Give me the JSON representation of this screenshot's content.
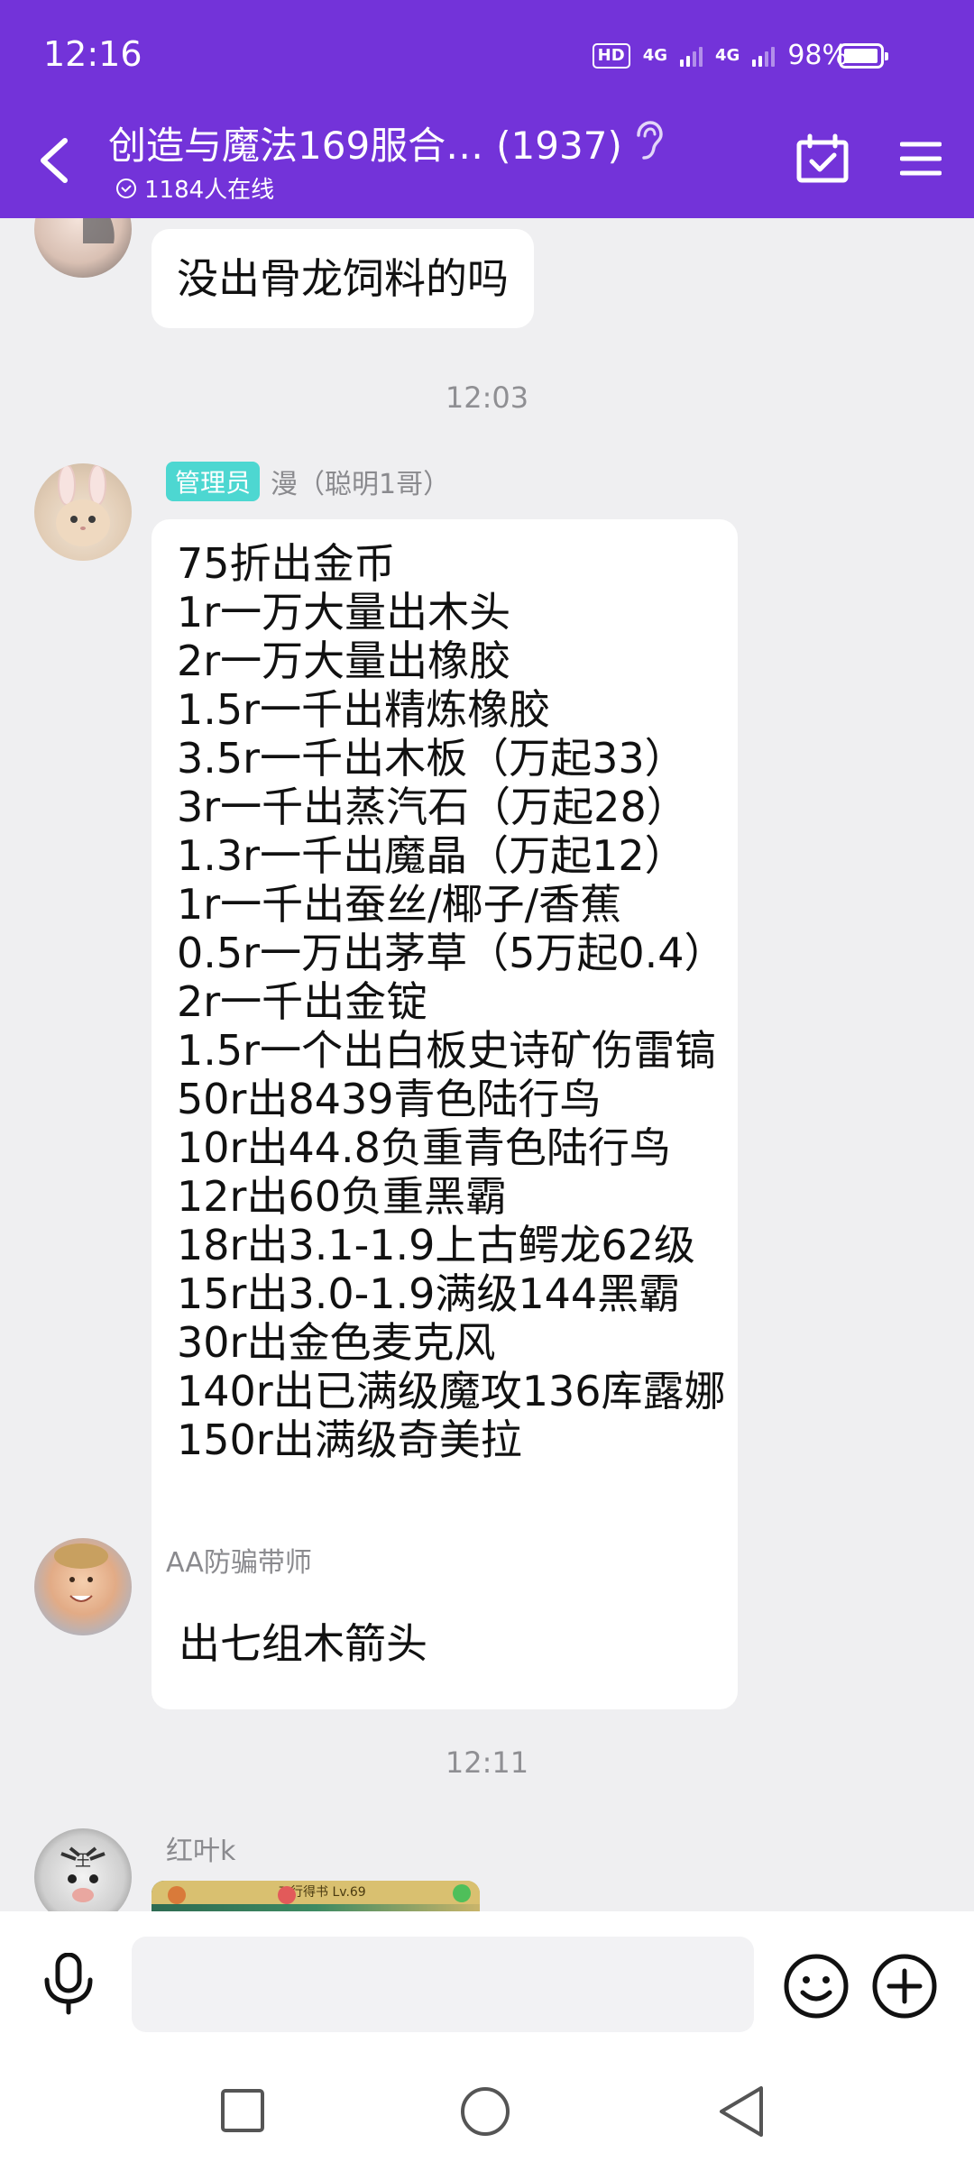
{
  "status_bar": {
    "time": "12:16",
    "hd": "HD",
    "network1": "4G",
    "network2": "4G",
    "battery": "98%"
  },
  "header": {
    "title": "创造与魔法169服合…",
    "member_count": "(1937)",
    "online": "1184人在线",
    "icons": [
      "back-icon",
      "ear-icon",
      "calendar-check-icon",
      "menu-icon"
    ]
  },
  "messages": [
    {
      "type": "text",
      "text": "没出骨龙饲料的吗"
    },
    {
      "type": "time",
      "text": "12:03"
    },
    {
      "type": "text",
      "badge": "管理员",
      "sender": "漫（聪明1哥）",
      "lines": [
        "75折出金币",
        "1r一万大量出木头",
        "2r一万大量出橡胶",
        "1.5r一千出精炼橡胶",
        "3.5r一千出木板（万起33）",
        "3r一千出蒸汽石（万起28）",
        "1.3r一千出魔晶（万起12）",
        "1r一千出蚕丝/椰子/香蕉",
        "0.5r一万出茅草（5万起0.4）",
        "2r一千出金锭",
        "1.5r一个出白板史诗矿伤雷镐",
        "50r出8439青色陆行鸟",
        "10r出44.8负重青色陆行鸟",
        "12r出60负重黑霸",
        "18r出3.1-1.9上古鳄龙62级",
        "15r出3.0-1.9满级144黑霸",
        "30r出金色麦克风",
        "140r出已满级魔攻136库露娜",
        "150r出满级奇美拉"
      ]
    },
    {
      "type": "text",
      "sender": "AA防骗带师",
      "text": "出七组木箭头"
    },
    {
      "type": "time",
      "text": "12:11"
    },
    {
      "type": "image",
      "sender": "红叶k",
      "image_caption": "三行得书 Lv.69"
    }
  ],
  "input": {
    "placeholder": ""
  },
  "colors": {
    "header": "#7333d9",
    "admin_badge": "#4dd7d1",
    "background": "#efeff1"
  }
}
